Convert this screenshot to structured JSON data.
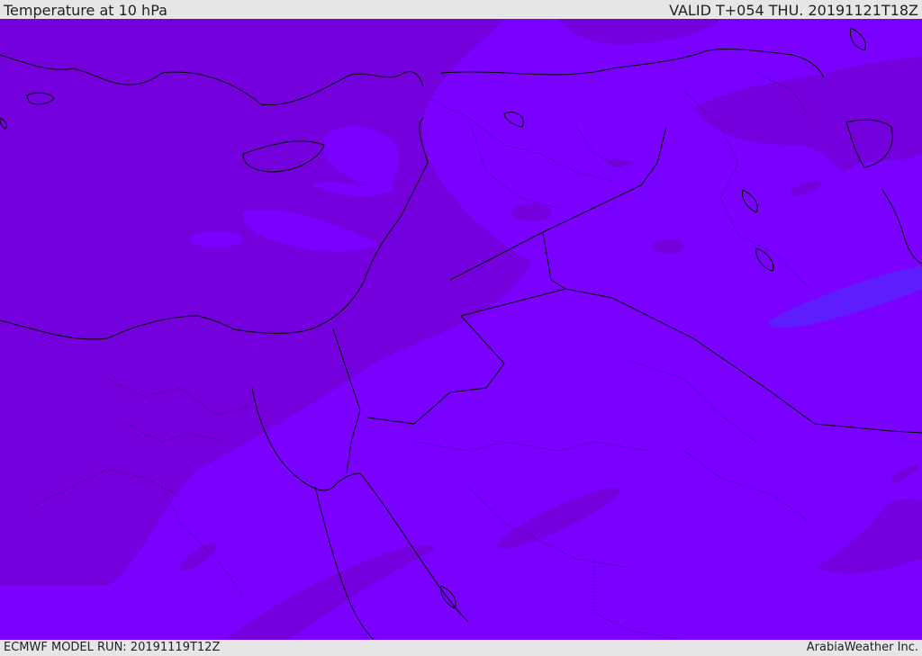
{
  "header": {
    "title": "Temperature at 10 hPa",
    "valid": "VALID T+054 THU. 20191121T18Z"
  },
  "footer": {
    "model_run": "ECMWF MODEL RUN: 20191119T12Z",
    "credit": "ArabiaWeather Inc."
  },
  "colors": {
    "dark_band": "#7300dd",
    "light_band": "#7a00ff",
    "blue_band": "#5e1dff",
    "border": "#000000"
  }
}
